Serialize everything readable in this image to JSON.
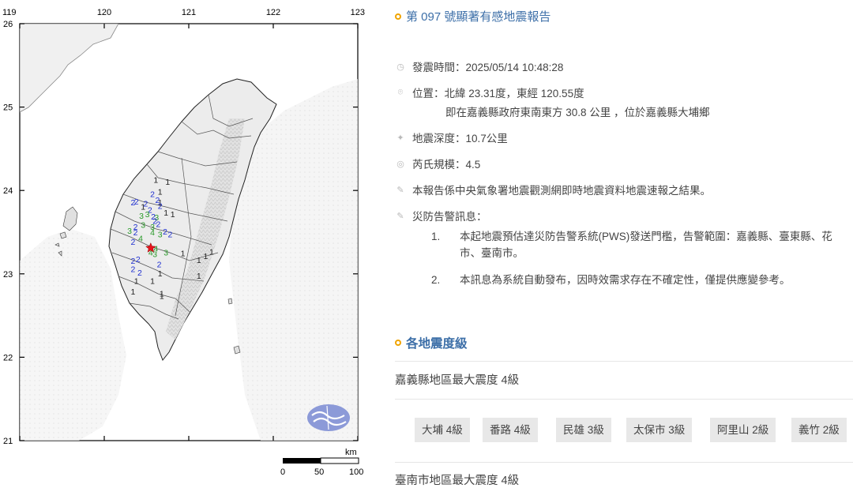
{
  "map": {
    "lon_labels": [
      "119",
      "120",
      "121",
      "122",
      "123"
    ],
    "lat_labels": [
      "26",
      "25",
      "24",
      "23",
      "22",
      "21"
    ],
    "scale": {
      "unit": "km",
      "ticks": [
        "0",
        "50",
        "100"
      ]
    },
    "epicenter": {
      "lat": 23.31,
      "lon": 120.55,
      "symbol": "star",
      "color": "#e8141c"
    },
    "intensity_colors": {
      "1": "#222222",
      "2": "#1f2fd0",
      "3": "#2a9a2a",
      "4": "#2a9a2a"
    },
    "stations": [
      {
        "v": "1",
        "lon": 120.61,
        "lat": 24.09
      },
      {
        "v": "1",
        "lon": 120.75,
        "lat": 24.07
      },
      {
        "v": "1",
        "lon": 120.66,
        "lat": 23.95
      },
      {
        "v": "2",
        "lon": 120.57,
        "lat": 23.92
      },
      {
        "v": "2",
        "lon": 120.63,
        "lat": 23.85
      },
      {
        "v": "1",
        "lon": 120.66,
        "lat": 23.82
      },
      {
        "v": "2",
        "lon": 120.34,
        "lat": 23.82
      },
      {
        "v": "2",
        "lon": 120.38,
        "lat": 23.83
      },
      {
        "v": "2",
        "lon": 120.49,
        "lat": 23.81
      },
      {
        "v": "1",
        "lon": 120.46,
        "lat": 23.77
      },
      {
        "v": "2",
        "lon": 120.66,
        "lat": 23.78
      },
      {
        "v": "2",
        "lon": 120.54,
        "lat": 23.73
      },
      {
        "v": "1",
        "lon": 120.73,
        "lat": 23.7
      },
      {
        "v": "1",
        "lon": 120.81,
        "lat": 23.68
      },
      {
        "v": "3",
        "lon": 120.44,
        "lat": 23.66
      },
      {
        "v": "3",
        "lon": 120.51,
        "lat": 23.68
      },
      {
        "v": "2",
        "lon": 120.58,
        "lat": 23.65
      },
      {
        "v": "3",
        "lon": 120.62,
        "lat": 23.64
      },
      {
        "v": "2",
        "lon": 120.6,
        "lat": 23.6
      },
      {
        "v": "2",
        "lon": 120.64,
        "lat": 23.56
      },
      {
        "v": "3",
        "lon": 120.46,
        "lat": 23.55
      },
      {
        "v": "3",
        "lon": 120.57,
        "lat": 23.53
      },
      {
        "v": "2",
        "lon": 120.37,
        "lat": 23.53
      },
      {
        "v": "2",
        "lon": 120.37,
        "lat": 23.46
      },
      {
        "v": "3",
        "lon": 120.3,
        "lat": 23.48
      },
      {
        "v": "4",
        "lon": 120.43,
        "lat": 23.39
      },
      {
        "v": "4",
        "lon": 120.57,
        "lat": 23.46
      },
      {
        "v": "2",
        "lon": 120.72,
        "lat": 23.47
      },
      {
        "v": "2",
        "lon": 120.78,
        "lat": 23.44
      },
      {
        "v": "3",
        "lon": 120.66,
        "lat": 23.44
      },
      {
        "v": "2",
        "lon": 120.34,
        "lat": 23.35
      },
      {
        "v": "4",
        "lon": 120.61,
        "lat": 23.27
      },
      {
        "v": "4",
        "lon": 120.55,
        "lat": 23.22
      },
      {
        "v": "3",
        "lon": 120.6,
        "lat": 23.2
      },
      {
        "v": "3",
        "lon": 120.73,
        "lat": 23.22
      },
      {
        "v": "2",
        "lon": 120.34,
        "lat": 23.12
      },
      {
        "v": "2",
        "lon": 120.4,
        "lat": 23.14
      },
      {
        "v": "2",
        "lon": 120.65,
        "lat": 23.08
      },
      {
        "v": "2",
        "lon": 120.34,
        "lat": 23.02
      },
      {
        "v": "2",
        "lon": 120.42,
        "lat": 22.98
      },
      {
        "v": "1",
        "lon": 120.66,
        "lat": 22.97
      },
      {
        "v": "1",
        "lon": 120.93,
        "lat": 23.21
      },
      {
        "v": "1",
        "lon": 121.2,
        "lat": 23.18
      },
      {
        "v": "1",
        "lon": 121.12,
        "lat": 23.13
      },
      {
        "v": "1",
        "lon": 121.27,
        "lat": 23.23
      },
      {
        "v": "1",
        "lon": 121.12,
        "lat": 22.94
      },
      {
        "v": "1",
        "lon": 120.38,
        "lat": 22.88
      },
      {
        "v": "1",
        "lon": 120.57,
        "lat": 22.88
      },
      {
        "v": "1",
        "lon": 120.34,
        "lat": 22.75
      },
      {
        "v": "1",
        "lon": 120.68,
        "lat": 22.73
      },
      {
        "v": "1",
        "lon": 120.68,
        "lat": 22.7
      }
    ]
  },
  "report": {
    "title": "第 097 號顯著有感地震報告",
    "time": "發震時間：2025/05/14 10:48:28",
    "location_line1": "位置：北緯 23.31度，東經 120.55度",
    "location_line2": "即在嘉義縣政府東南東方 30.8 公里 ，位於嘉義縣大埔鄉",
    "depth": "地震深度：10.7公里",
    "magnitude": "芮氏規模：4.5",
    "source_note": "本報告係中央氣象署地震觀測網即時地震資料地震速報之結果。",
    "alert_heading": "災防告警訊息：",
    "alerts": [
      {
        "num": "1.",
        "line1": "本起地震預估達災防告警系統(PWS)發送門檻，告警範圍：嘉義縣、臺東縣、花",
        "line2": "市、臺南市。"
      },
      {
        "num": "2.",
        "line1": "本訊息為系統自動發布，因時效需求存在不確定性，僅提供應變參考。",
        "line2": ""
      }
    ],
    "intensity_section": "各地震度級",
    "region1_title": "嘉義縣地區最大震度 4級",
    "region1_badges": [
      "大埔 4級",
      "番路 4級",
      "民雄 3級",
      "太保市 3級",
      "阿里山 2級",
      "義竹 2級"
    ],
    "region2_title": "臺南市地區最大震度 4級"
  },
  "colors": {
    "accent": "#3d6fa8",
    "bullet": "#f0a400",
    "badge_bg": "#e8e8e8"
  }
}
